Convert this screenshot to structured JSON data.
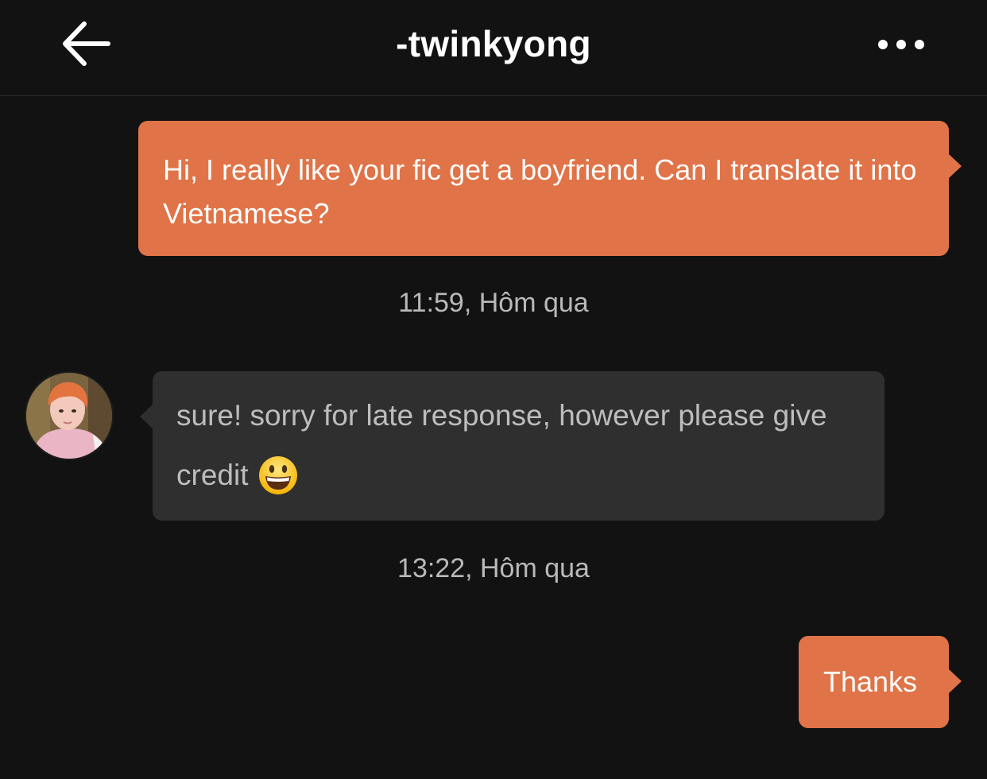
{
  "header": {
    "title": "-twinkyong",
    "back_icon": "arrow-left-icon",
    "more_icon": "more-horizontal-icon"
  },
  "messages": [
    {
      "direction": "outgoing",
      "text": "Hi, I really like your fic get a boyfriend. Can I translate it into Vietnamese?"
    },
    {
      "direction": "incoming",
      "text_line1": "sure! sorry for late response, however please give",
      "text_line2": "credit",
      "emoji": "grinning-face-emoji"
    },
    {
      "direction": "outgoing",
      "text": "Thanks"
    }
  ],
  "timestamps": [
    "11:59, Hôm qua",
    "13:22, Hôm qua"
  ],
  "colors": {
    "background": "#121212",
    "outgoing_bubble": "#e07347",
    "incoming_bubble": "#2f2f2f",
    "timestamp_text": "#b9b9b9"
  }
}
